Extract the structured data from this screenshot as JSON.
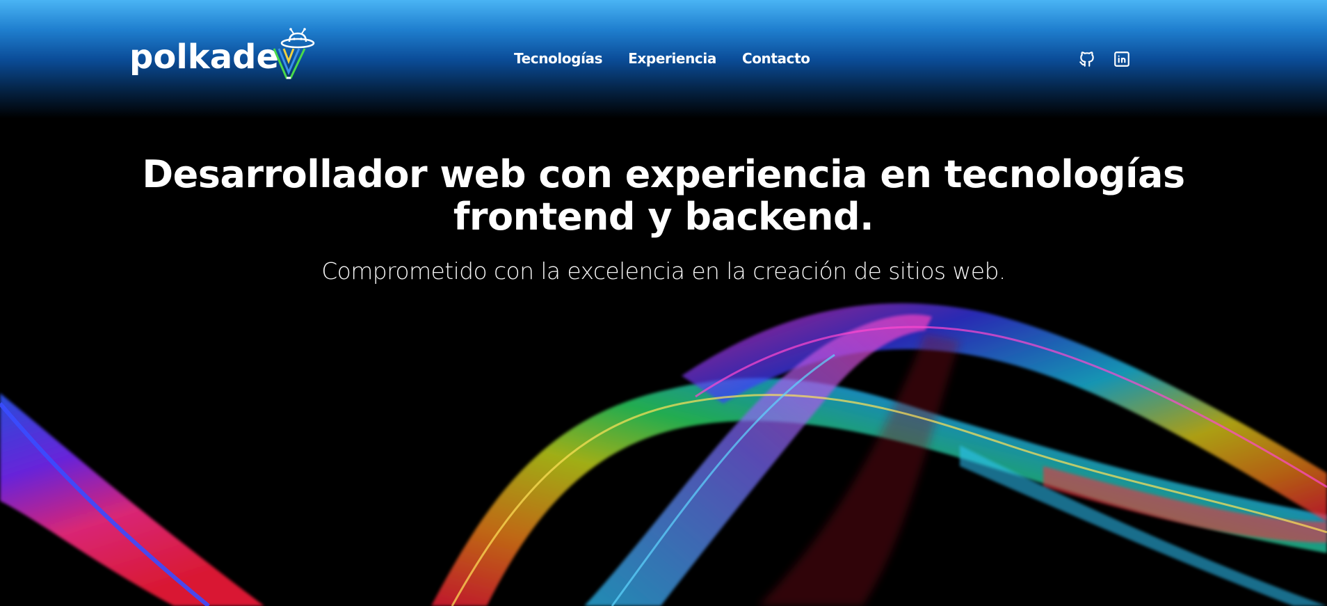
{
  "brand": {
    "name": "polkade",
    "logo_icon": "ufo-icon"
  },
  "nav": {
    "items": [
      {
        "label": "Tecnologías"
      },
      {
        "label": "Experiencia"
      },
      {
        "label": "Contacto"
      }
    ]
  },
  "social": {
    "github_icon": "github-icon",
    "linkedin_icon": "linkedin-icon"
  },
  "hero": {
    "title_line1": "Desarrollador web con experiencia en tecnologías",
    "title_line2": "frontend y backend.",
    "subtitle": "Comprometido con la excelencia en la creación de sitios web."
  },
  "colors": {
    "header_top": "#4ab4f4",
    "header_mid": "#0b4d99",
    "background": "#000000",
    "text": "#ffffff",
    "logo_v_green": "#4ad94a",
    "logo_v_blue": "#3a8fe8"
  }
}
